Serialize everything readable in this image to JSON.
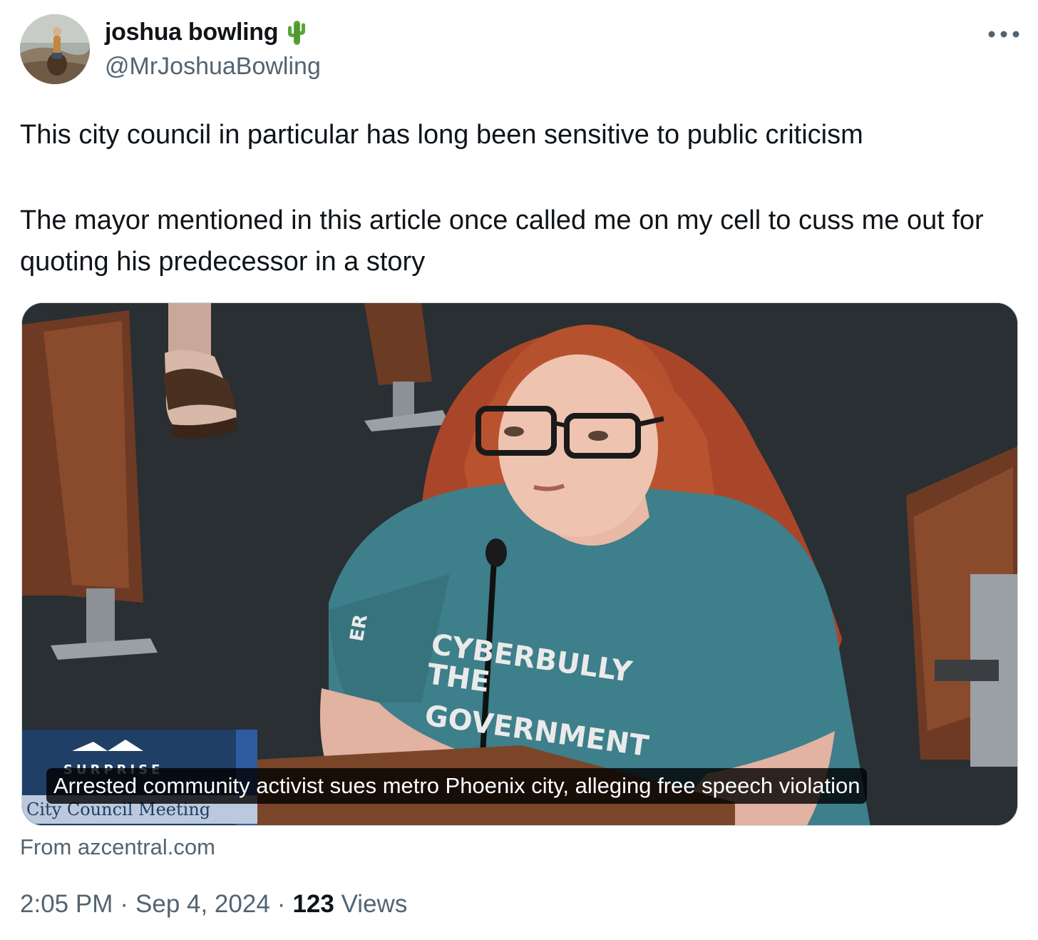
{
  "author": {
    "name": "joshua bowling",
    "name_emoji": "cactus-icon",
    "handle": "@MrJoshuaBowling"
  },
  "tweet": {
    "paragraphs": [
      "This city council in particular has long been sensitive to public criticism",
      "The mayor mentioned in this article once called me on my cell to cuss me out for quoting his predecessor in a story"
    ]
  },
  "card": {
    "caption": "Arrested community activist sues metro Phoenix city, alleging free speech violation",
    "source": "From azcentral.com",
    "image_text": {
      "shirt_line1": "CYBERBULLY",
      "shirt_line2": "THE",
      "shirt_line3": "GOVERNMENT",
      "sleeve": "ER",
      "logo_word": "SURPRISE",
      "banner": "City Council Meeting"
    }
  },
  "meta": {
    "time": "2:05 PM",
    "date": "Sep 4, 2024",
    "separator": "·",
    "views_count": "123",
    "views_label": "Views"
  },
  "colors": {
    "text_primary": "#0f1419",
    "text_secondary": "#536471",
    "card_border": "#cfd9de",
    "shirt_teal": "#3d7f8a",
    "hair_red": "#b5512c"
  }
}
